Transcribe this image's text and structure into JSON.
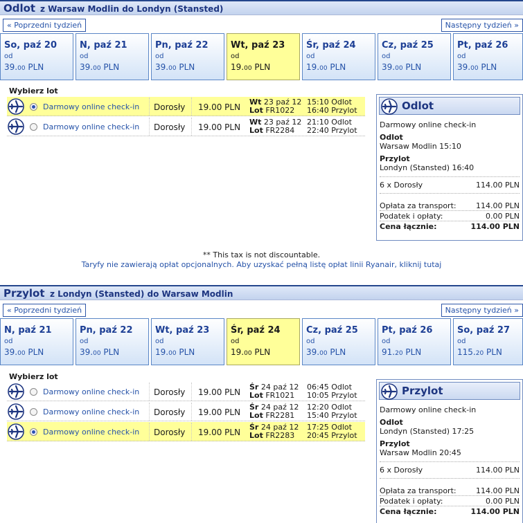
{
  "outbound": {
    "title": "Odlot",
    "route": "z Warsaw Modlin do Londyn (Stansted)",
    "prev_week": "« Poprzedni tydzień",
    "next_week": "Następny tydzień »",
    "days": [
      {
        "label": "So, paź 20",
        "od": "od",
        "price_int": "39.",
        "price_dec": "00",
        "currency": " PLN",
        "selected": false
      },
      {
        "label": "N, paź 21",
        "od": "od",
        "price_int": "39.",
        "price_dec": "00",
        "currency": " PLN",
        "selected": false
      },
      {
        "label": "Pn, paź 22",
        "od": "od",
        "price_int": "39.",
        "price_dec": "00",
        "currency": " PLN",
        "selected": false
      },
      {
        "label": "Wt, paź 23",
        "od": "od",
        "price_int": "19.",
        "price_dec": "00",
        "currency": " PLN",
        "selected": true
      },
      {
        "label": "Śr, paź 24",
        "od": "od",
        "price_int": "19.",
        "price_dec": "00",
        "currency": " PLN",
        "selected": false
      },
      {
        "label": "Cz, paź 25",
        "od": "od",
        "price_int": "39.",
        "price_dec": "00",
        "currency": " PLN",
        "selected": false
      },
      {
        "label": "Pt, paź 26",
        "od": "od",
        "price_int": "39.",
        "price_dec": "00",
        "currency": " PLN",
        "selected": false
      }
    ],
    "choose_label": "Wybierz lot",
    "flights": [
      {
        "checkin": "Darmowy online check-in",
        "passenger": "Dorosły",
        "price": "19.00 PLN",
        "day": "Wt",
        "date": "23 paź 12",
        "lot": "Lot",
        "flight_no": "FR1022",
        "dep_time": "15:10",
        "dep_label": "Odlot",
        "arr_time": "16:40",
        "arr_label": "Przylot",
        "selected": true
      },
      {
        "checkin": "Darmowy online check-in",
        "passenger": "Dorosły",
        "price": "19.00 PLN",
        "day": "Wt",
        "date": "23 paź 12",
        "lot": "Lot",
        "flight_no": "FR2284",
        "dep_time": "21:10",
        "dep_label": "Odlot",
        "arr_time": "22:40",
        "arr_label": "Przylot",
        "selected": false
      }
    ],
    "summary": {
      "title": "Odlot",
      "checkin": "Darmowy online check-in",
      "dep_label": "Odlot",
      "dep_value": "Warsaw Modlin 15:10",
      "arr_label": "Przylot",
      "arr_value": "Londyn (Stansted) 16:40",
      "pax_label": "6 x Dorosły",
      "pax_value": "114.00 PLN",
      "transport_label": "Opłata za transport:",
      "transport_value": "114.00 PLN",
      "tax_label": "Podatek i opłaty:",
      "tax_value": "0.00 PLN",
      "total_label": "Cena łącznie:",
      "total_value": "114.00 PLN"
    },
    "note": "** This tax is not discountable.",
    "fees_link": "Taryfy nie zawierają opłat opcjonalnych. Aby uzyskać pełną listę opłat linii Ryanair, kliknij tutaj"
  },
  "return": {
    "title": "Przylot",
    "route": "z Londyn (Stansted) do Warsaw Modlin",
    "prev_week": "« Poprzedni tydzień",
    "next_week": "Następny tydzień »",
    "days": [
      {
        "label": "N, paź 21",
        "od": "od",
        "price_int": "39.",
        "price_dec": "00",
        "currency": " PLN",
        "selected": false
      },
      {
        "label": "Pn, paź 22",
        "od": "od",
        "price_int": "39.",
        "price_dec": "00",
        "currency": " PLN",
        "selected": false
      },
      {
        "label": "Wt, paź 23",
        "od": "od",
        "price_int": "19.",
        "price_dec": "00",
        "currency": " PLN",
        "selected": false
      },
      {
        "label": "Śr, paź 24",
        "od": "od",
        "price_int": "19.",
        "price_dec": "00",
        "currency": " PLN",
        "selected": true
      },
      {
        "label": "Cz, paź 25",
        "od": "od",
        "price_int": "39.",
        "price_dec": "00",
        "currency": " PLN",
        "selected": false
      },
      {
        "label": "Pt, paź 26",
        "od": "od",
        "price_int": "91.",
        "price_dec": "20",
        "currency": " PLN",
        "selected": false
      },
      {
        "label": "So, paź 27",
        "od": "od",
        "price_int": "115.",
        "price_dec": "20",
        "currency": " PLN",
        "selected": false
      }
    ],
    "choose_label": "Wybierz lot",
    "flights": [
      {
        "checkin": "Darmowy online check-in",
        "passenger": "Dorosły",
        "price": "19.00 PLN",
        "day": "Śr",
        "date": "24 paź 12",
        "lot": "Lot",
        "flight_no": "FR1021",
        "dep_time": "06:45",
        "dep_label": "Odlot",
        "arr_time": "10:05",
        "arr_label": "Przylot",
        "selected": false
      },
      {
        "checkin": "Darmowy online check-in",
        "passenger": "Dorosły",
        "price": "19.00 PLN",
        "day": "Śr",
        "date": "24 paź 12",
        "lot": "Lot",
        "flight_no": "FR2281",
        "dep_time": "12:20",
        "dep_label": "Odlot",
        "arr_time": "15:40",
        "arr_label": "Przylot",
        "selected": false
      },
      {
        "checkin": "Darmowy online check-in",
        "passenger": "Dorosły",
        "price": "19.00 PLN",
        "day": "Śr",
        "date": "24 paź 12",
        "lot": "Lot",
        "flight_no": "FR2283",
        "dep_time": "17:25",
        "dep_label": "Odlot",
        "arr_time": "20:45",
        "arr_label": "Przylot",
        "selected": true
      }
    ],
    "summary": {
      "title": "Przylot",
      "checkin": "Darmowy online check-in",
      "dep_label": "Odlot",
      "dep_value": "Londyn (Stansted) 17:25",
      "arr_label": "Przylot",
      "arr_value": "Warsaw Modlin 20:45",
      "pax_label": "6 x Dorosły",
      "pax_value": "114.00 PLN",
      "transport_label": "Opłata za transport:",
      "transport_value": "114.00 PLN",
      "tax_label": "Podatek i opłaty:",
      "tax_value": "0.00 PLN",
      "total_label": "Cena łącznie:",
      "total_value": "114.00 PLN"
    }
  },
  "colors": {
    "accent": "#1d3580",
    "link": "#2552a8",
    "selected": "#ffff99"
  }
}
